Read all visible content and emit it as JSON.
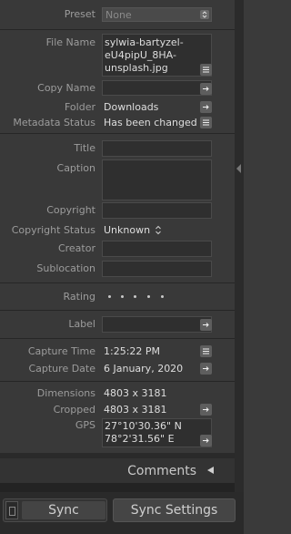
{
  "preset": {
    "label": "Preset",
    "value": "None"
  },
  "fields": {
    "file_name_label": "File Name",
    "file_name_line1": "sylwia-bartyzel-",
    "file_name_line2": "eU4pipU_8HA-",
    "file_name_line3": "unsplash.jpg",
    "copy_name_label": "Copy Name",
    "folder_label": "Folder",
    "folder_value": "Downloads",
    "metadata_status_label": "Metadata Status",
    "metadata_status_value": "Has been changed",
    "title_label": "Title",
    "caption_label": "Caption",
    "copyright_label": "Copyright",
    "copyright_status_label": "Copyright Status",
    "copyright_status_value": "Unknown",
    "creator_label": "Creator",
    "sublocation_label": "Sublocation",
    "rating_label": "Rating",
    "label_label": "Label",
    "capture_time_label": "Capture Time",
    "capture_time_value": "1:25:22 PM",
    "capture_date_label": "Capture Date",
    "capture_date_value": "6 January, 2020",
    "dimensions_label": "Dimensions",
    "dimensions_value": "4803 x 3181",
    "cropped_label": "Cropped",
    "cropped_value": "4803 x 3181",
    "gps_label": "GPS",
    "gps_line1": "27°10'30.36\" N",
    "gps_line2": "78°2'31.56\" E"
  },
  "comments": {
    "label": "Comments"
  },
  "footer": {
    "sync_label": "Sync",
    "sync_settings_label": "Sync Settings"
  },
  "colors": {
    "panel_bg": "#393939",
    "field_bg": "#2f2f2f",
    "label_text": "#9c9c9c",
    "value_text": "#dedede"
  }
}
